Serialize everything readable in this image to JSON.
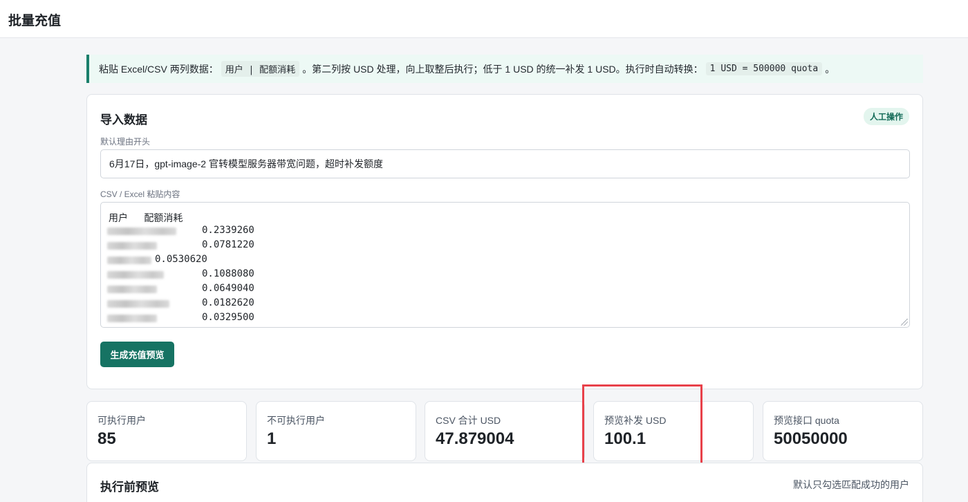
{
  "header": {
    "title": "批量充值"
  },
  "notice": {
    "text_1": "粘贴 Excel/CSV 两列数据：",
    "code_1": "用户 | 配额消耗",
    "text_2": "。第二列按 USD 处理，向上取整后执行；低于 1 USD 的统一补发 1 USD。执行时自动转换：",
    "code_2": "1 USD = 500000 quota",
    "text_3": "。"
  },
  "import_section": {
    "title": "导入数据",
    "badge": "人工操作",
    "reason_label": "默认理由开头",
    "reason_value": "6月17日，gpt-image-2 官转模型服务器带宽问题，超时补发额度",
    "csv_label": "CSV / Excel 粘贴内容",
    "csv_header": "用户      配额消耗",
    "csv_values": [
      "0.2339260",
      "0.0781220",
      "0.0530620",
      "0.1088080",
      "0.0649040",
      "0.0182620",
      "0.0329500"
    ],
    "generate_button": "生成充值预览"
  },
  "stats": [
    {
      "label": "可执行用户",
      "value": "85"
    },
    {
      "label": "不可执行用户",
      "value": "1"
    },
    {
      "label": "CSV 合计 USD",
      "value": "47.879004"
    },
    {
      "label": "预览补发 USD",
      "value": "100.1"
    },
    {
      "label": "预览接口 quota",
      "value": "50050000"
    }
  ],
  "preview_section": {
    "title": "执行前预览",
    "hint": "默认只勾选匹配成功的用户"
  },
  "colors": {
    "accent": "#167363",
    "highlight": "#e8414a",
    "notice_bg": "#edf9f5"
  }
}
